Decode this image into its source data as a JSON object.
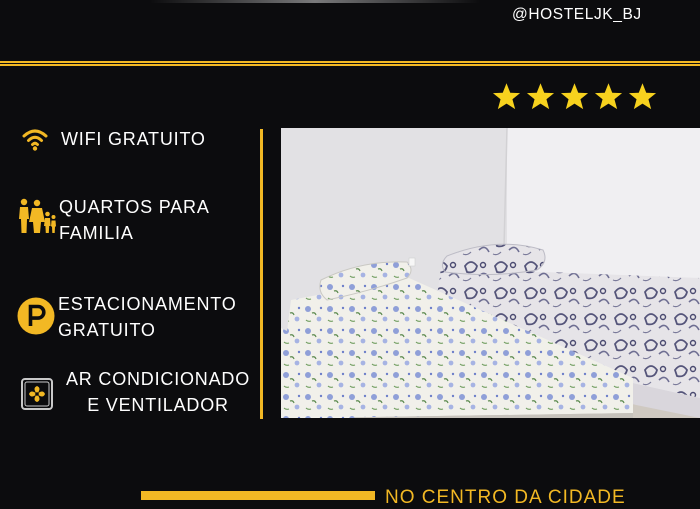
{
  "header": {
    "handle": "@HOSTELJK_BJ"
  },
  "rating": {
    "stars": 5,
    "max_stars": 5,
    "star_color": "#f7d21e"
  },
  "features": [
    {
      "icon": "wifi-icon",
      "lines": [
        "WIFI GRATUITO"
      ]
    },
    {
      "icon": "family-icon",
      "lines": [
        "QUARTOS PARA",
        "FAMILIA"
      ]
    },
    {
      "icon": "parking-icon",
      "lines": [
        "ESTACIONAMENTO",
        "GRATUITO"
      ]
    },
    {
      "icon": "air-conditioner-icon",
      "lines": [
        "AR CONDICIONADO",
        "E VENTILADOR"
      ]
    }
  ],
  "footer": {
    "text": "NO CENTRO DA CIDADE"
  },
  "colors": {
    "background": "#0c0c0e",
    "accent": "#f2b824",
    "text": "#ffffff"
  }
}
